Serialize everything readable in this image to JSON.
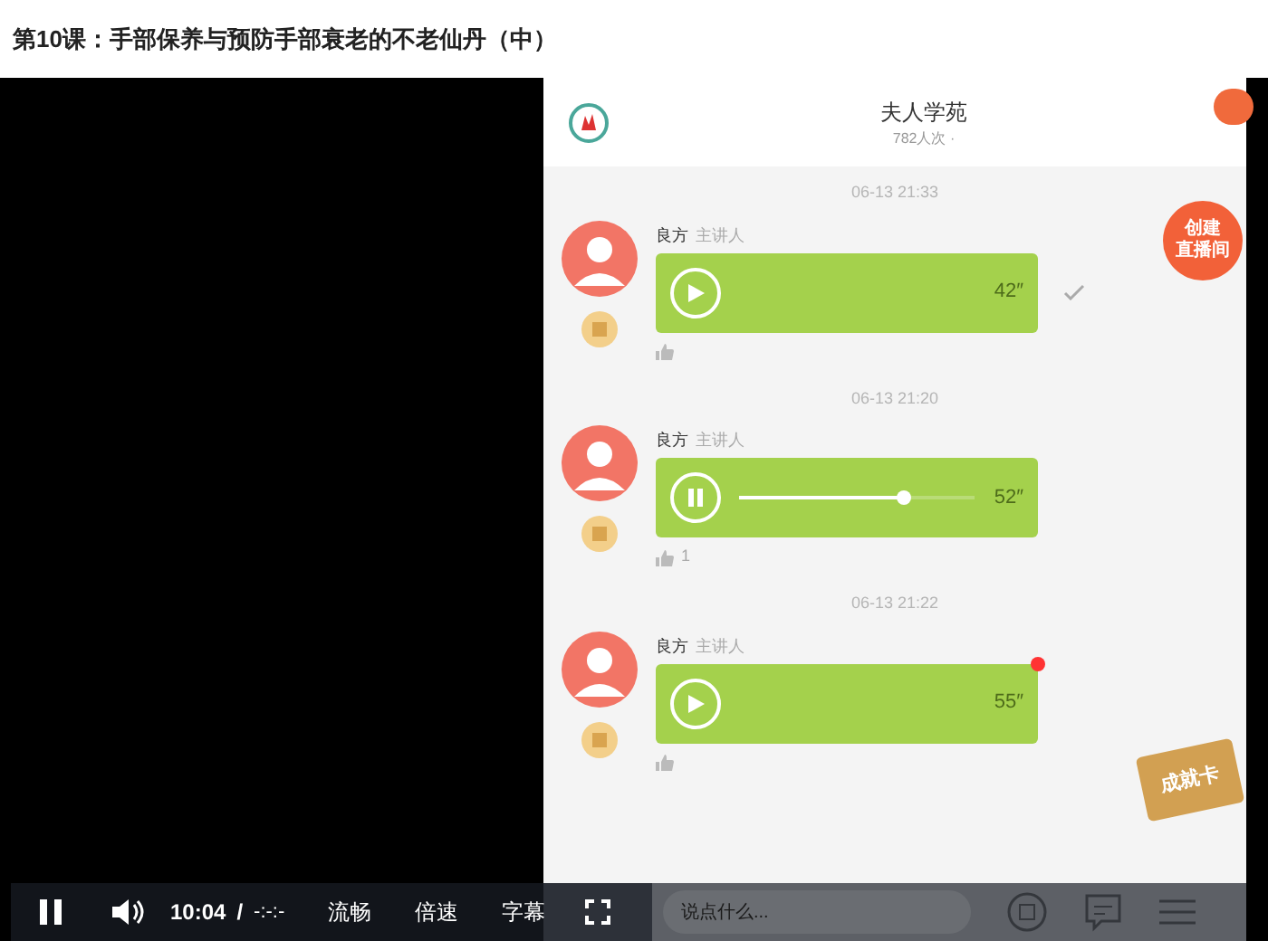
{
  "page_title": "第10课：手部保养与预防手部衰老的不老仙丹（中）",
  "app": {
    "title": "夫人学苑",
    "subtitle": "782人次 ·",
    "create_button": [
      "创建",
      "直播间"
    ],
    "badge": "成就卡",
    "messages": [
      {
        "time": "06-13 21:33",
        "speaker": "良方",
        "role": "主讲人",
        "duration": "42″",
        "playing": false,
        "read_tick": true,
        "unread": false
      },
      {
        "time": "06-13 21:20",
        "speaker": "良方",
        "role": "主讲人",
        "duration": "52″",
        "playing": true,
        "level": 0.7,
        "read_tick": false,
        "unread": false,
        "likes": "1"
      },
      {
        "time": "06-13 21:22",
        "speaker": "良方",
        "role": "主讲人",
        "duration": "55″",
        "playing": false,
        "read_tick": false,
        "unread": true
      }
    ],
    "input": {
      "placeholder": "说点什么..."
    }
  },
  "player": {
    "playing": true,
    "time": "10:04",
    "separator": "/",
    "duration": "-:-:-",
    "buttons": [
      "流畅",
      "倍速",
      "字幕"
    ]
  }
}
